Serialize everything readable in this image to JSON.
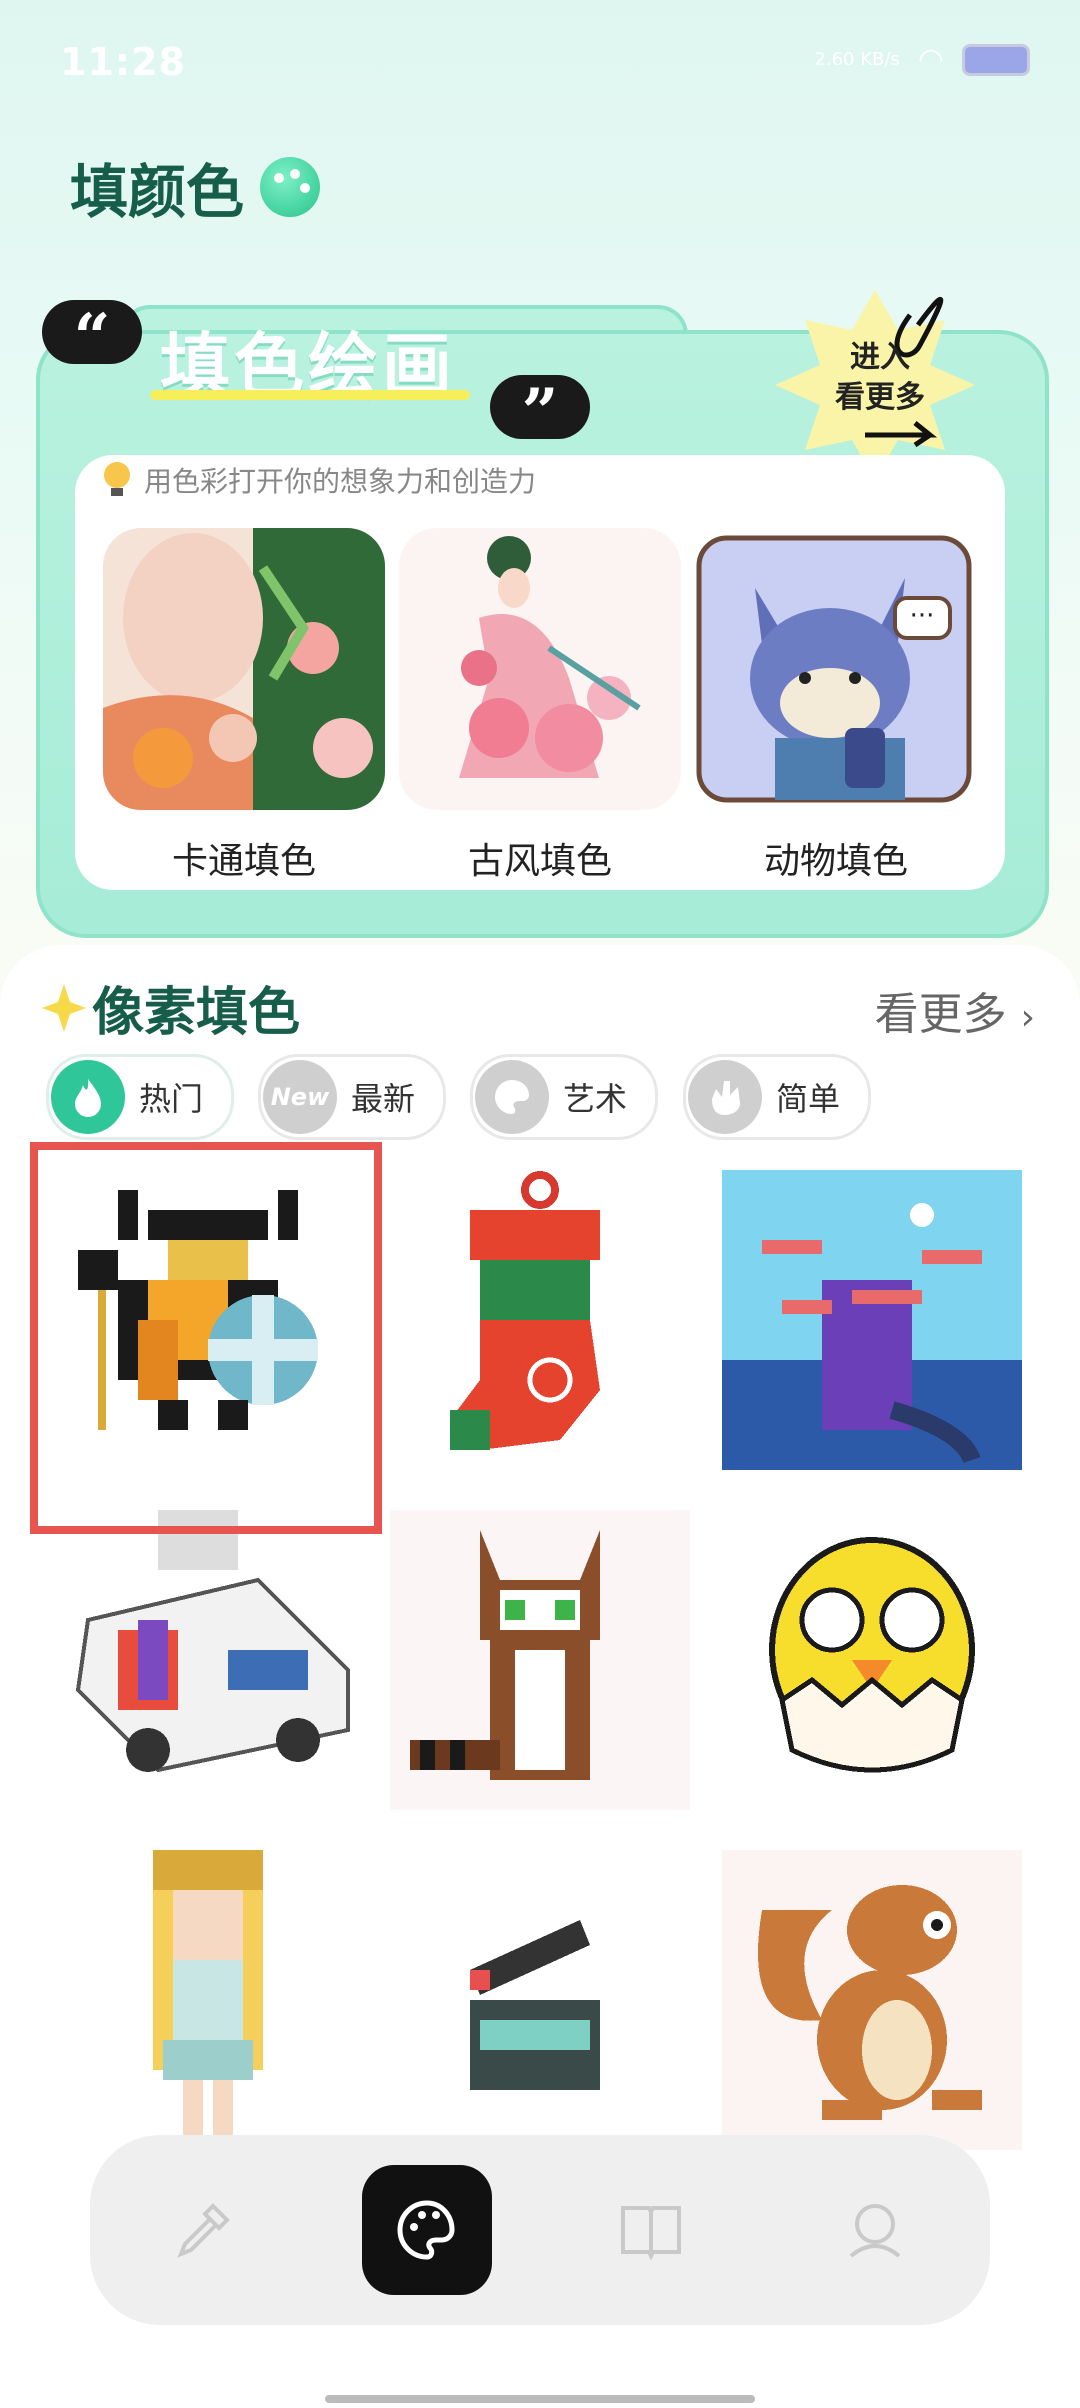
{
  "status_bar": {
    "time": "11:28",
    "network": "2.60 KB/s"
  },
  "app": {
    "title": "填颜色"
  },
  "banner": {
    "title": "填色绘画",
    "badge_line1": "进入",
    "badge_line2": "看更多",
    "subtitle": "用色彩打开你的想象力和创造力",
    "categories": [
      {
        "label": "卡通填色"
      },
      {
        "label": "古风填色"
      },
      {
        "label": "动物填色"
      }
    ]
  },
  "pixel_section": {
    "title": "像素填色",
    "see_more": "看更多",
    "chips": [
      {
        "label": "热门",
        "icon": "fire-icon",
        "color": "#2fc79a"
      },
      {
        "label": "最新",
        "icon": "new-icon",
        "color": "#cfcfcf",
        "icon_text": "New"
      },
      {
        "label": "艺术",
        "icon": "palette-icon",
        "color": "#cfcfcf"
      },
      {
        "label": "简单",
        "icon": "hand-icon",
        "color": "#cfcfcf"
      }
    ],
    "tiles": [
      {
        "name": "viking"
      },
      {
        "name": "christmas-stocking"
      },
      {
        "name": "tree-house"
      },
      {
        "name": "news-van"
      },
      {
        "name": "raccoon"
      },
      {
        "name": "chick"
      },
      {
        "name": "girl"
      },
      {
        "name": "clapperboard"
      },
      {
        "name": "squirrel"
      }
    ]
  },
  "nav": {
    "items": [
      {
        "icon": "pipette-icon"
      },
      {
        "icon": "palette-icon"
      },
      {
        "icon": "book-icon"
      },
      {
        "icon": "profile-icon"
      }
    ]
  },
  "colors": {
    "brand_green": "#165d4a",
    "accent": "#2fc79a",
    "highlight": "#e85450"
  }
}
